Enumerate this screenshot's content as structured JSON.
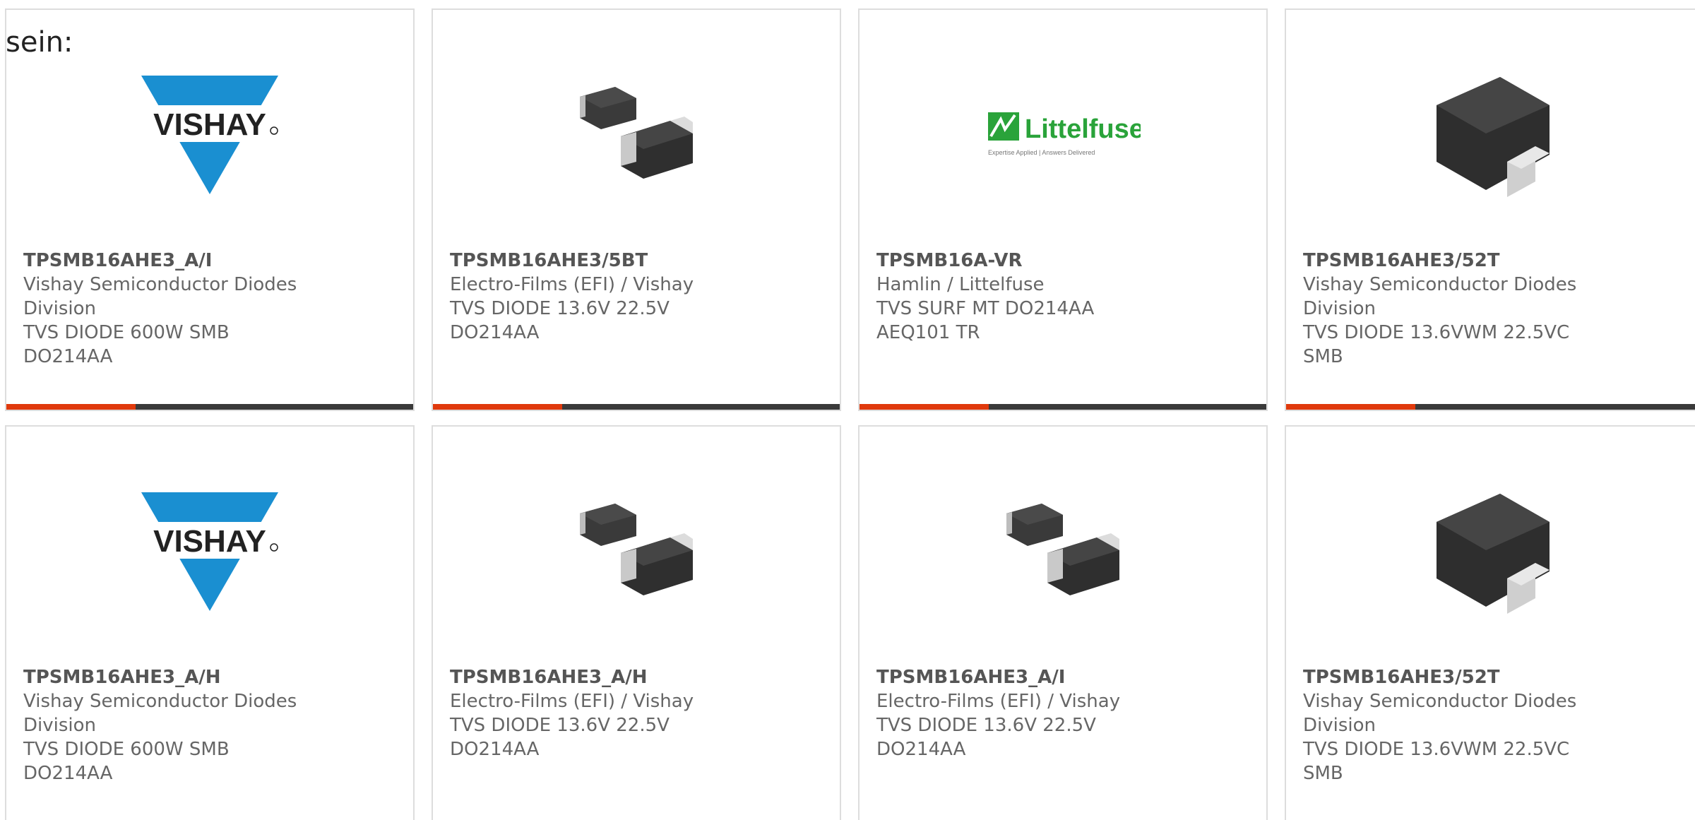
{
  "lead_text": "sein:",
  "cards": [
    {
      "image_icon": "vishay-logo",
      "logo_text": "VISHAY",
      "part_number": "TPSMB16AHE3_A/I",
      "manufacturer": "Vishay Semiconductor Diodes Division",
      "description": "TVS DIODE 600W SMB DO214AA"
    },
    {
      "image_icon": "smd-diode-pair-image",
      "part_number": "TPSMB16AHE3/5BT",
      "manufacturer": "Electro-Films (EFI) / Vishay",
      "description": "TVS DIODE 13.6V 22.5V DO214AA"
    },
    {
      "image_icon": "littelfuse-logo",
      "logo_text": "Littelfuse",
      "logo_tagline": "Expertise Applied | Answers Delivered",
      "part_number": "TPSMB16A-VR",
      "manufacturer": "Hamlin / Littelfuse",
      "description": "TVS SURF MT DO214AA AEQ101 TR"
    },
    {
      "image_icon": "smb-diode-package-image",
      "part_number": "TPSMB16AHE3/52T",
      "manufacturer": "Vishay Semiconductor Diodes Division",
      "description": "TVS DIODE 13.6VWM 22.5VC SMB"
    },
    {
      "image_icon": "vishay-logo",
      "logo_text": "VISHAY",
      "part_number": "TPSMB16AHE3_A/H",
      "manufacturer": "Vishay Semiconductor Diodes Division",
      "description": "TVS DIODE 600W SMB DO214AA"
    },
    {
      "image_icon": "smd-diode-pair-image",
      "part_number": "TPSMB16AHE3_A/H",
      "manufacturer": "Electro-Films (EFI) / Vishay",
      "description": "TVS DIODE 13.6V 22.5V DO214AA"
    },
    {
      "image_icon": "smd-diode-pair-image",
      "part_number": "TPSMB16AHE3_A/I",
      "manufacturer": "Electro-Films (EFI) / Vishay",
      "description": "TVS DIODE 13.6V 22.5V DO214AA"
    },
    {
      "image_icon": "smb-diode-package-image",
      "part_number": "TPSMB16AHE3/52T",
      "manufacturer": "Vishay Semiconductor Diodes Division",
      "description": "TVS DIODE 13.6VWM 22.5VC SMB"
    }
  ],
  "colors": {
    "accent": "#e0390c",
    "bar": "#3a3a3a",
    "vishay_blue": "#1a8fd1",
    "littelfuse_green": "#2aa33a"
  }
}
